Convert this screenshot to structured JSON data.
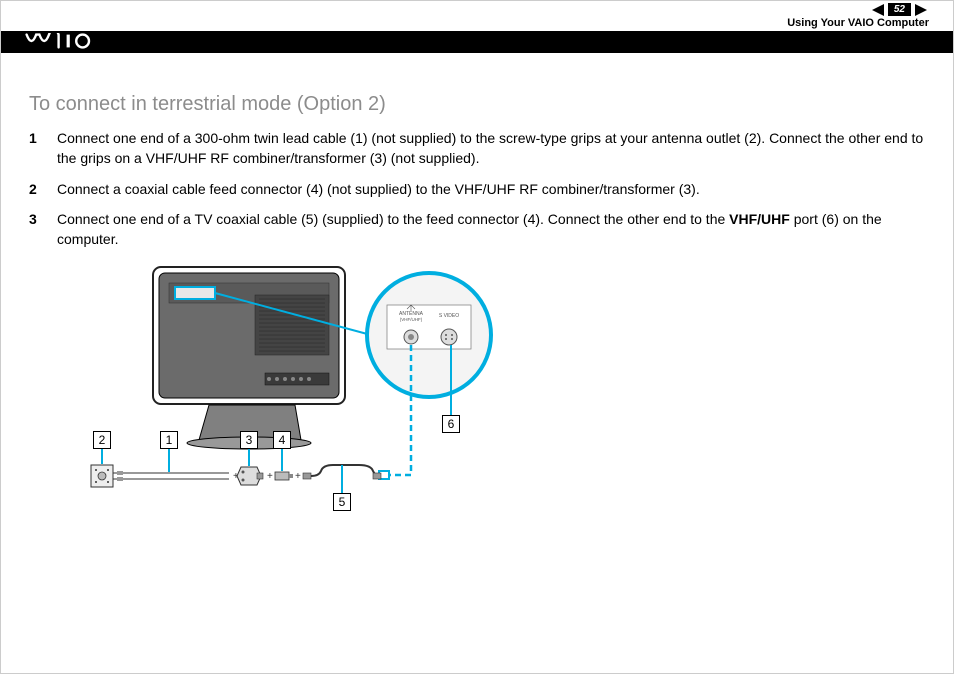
{
  "header": {
    "page_number": "52",
    "section": "Using Your VAIO Computer",
    "logo_text": "VAIO"
  },
  "content": {
    "heading": "To connect in terrestrial mode (Option 2)",
    "steps": [
      "Connect one end of a 300-ohm twin lead cable (1) (not supplied) to the screw-type grips at your antenna outlet (2). Connect the other end to the grips on a VHF/UHF RF combiner/transformer (3) (not supplied).",
      "Connect a coaxial cable feed connector (4) (not supplied) to the VHF/UHF RF combiner/transformer (3).",
      "Connect one end of a TV coaxial cable (5) (supplied) to the feed connector (4). Connect the other end to the {{bold}} port (6) on the computer."
    ],
    "bold_port": "VHF/UHF"
  },
  "diagram": {
    "callouts": {
      "n1": "1",
      "n2": "2",
      "n3": "3",
      "n4": "4",
      "n5": "5",
      "n6": "6"
    },
    "zoom_labels": {
      "antenna": "ANTENNA",
      "sub": "(VHF/UHF)",
      "svideo": "S VIDEO"
    }
  }
}
